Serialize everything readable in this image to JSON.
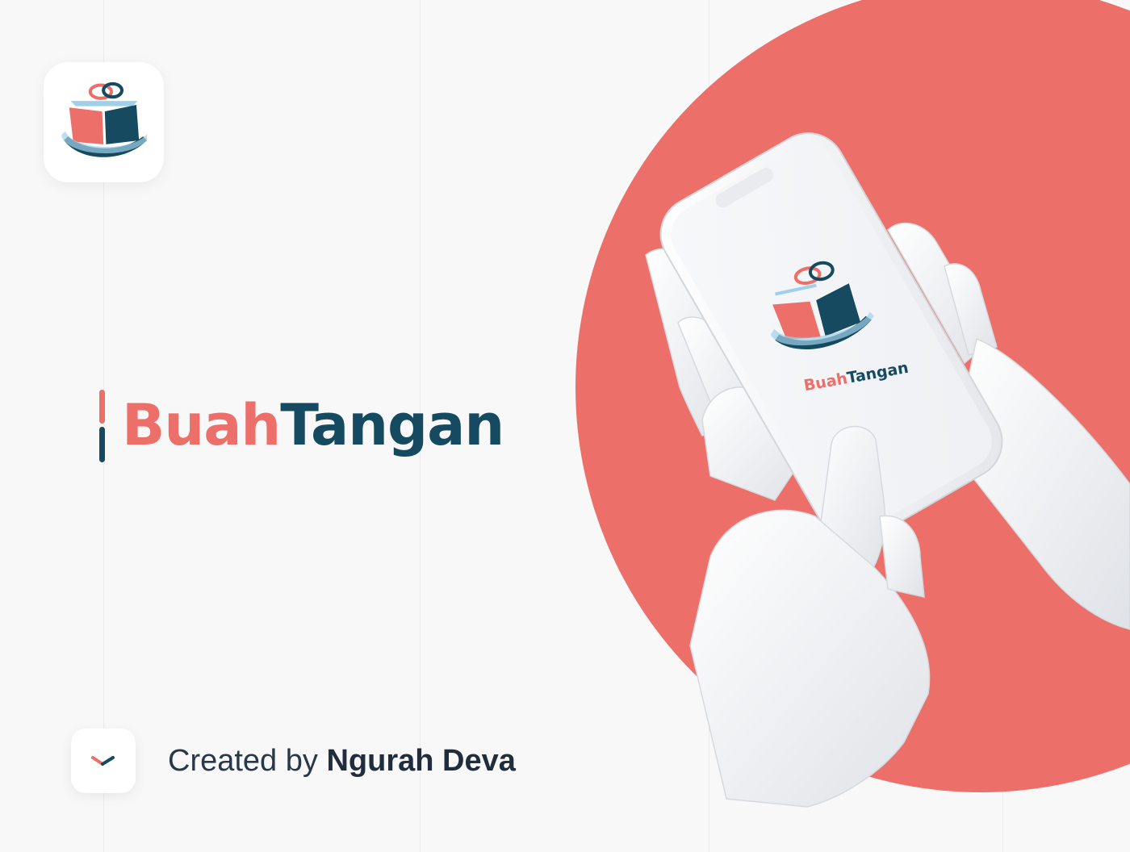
{
  "brand": {
    "part1": "Buah",
    "part2": "Tangan",
    "accent_color": "#ec6f69",
    "dark_color": "#154a60"
  },
  "app_icon": {
    "icon": "gift-book-hand-logo"
  },
  "phone": {
    "screen_brand_part1": "Buah",
    "screen_brand_part2": "Tangan"
  },
  "credit": {
    "prefix": "Created by",
    "name": "Ngurah Deva",
    "icon": "chevron-down-icon"
  },
  "background": {
    "circle_color": "#ec6f69",
    "page_color": "#f8f8f9"
  }
}
